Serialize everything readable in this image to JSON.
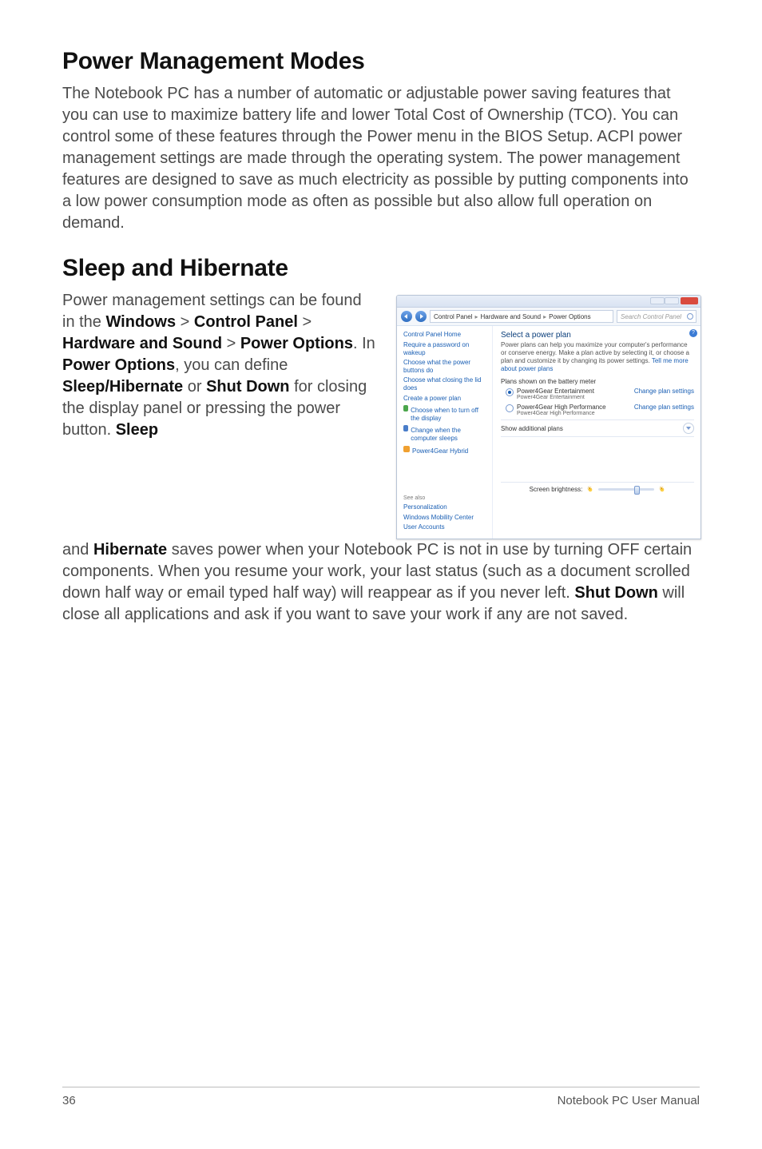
{
  "headings": {
    "h1": "Power Management Modes",
    "h2": "Sleep and Hibernate"
  },
  "paragraphs": {
    "p1": "The Notebook PC has a number of automatic or adjustable power saving features that you can use to maximize battery life and lower Total Cost of Ownership (TCO). You can control some of these features through the Power menu in the BIOS Setup. ACPI power management settings are made through the operating system. The power management features are designed to save as much electricity as possible by putting components into a low power consumption mode as often as possible but also allow full operation on demand.",
    "p2_pre": "Power management settings can be found in the ",
    "p2_b1": "Windows",
    "p2_gt1": " > ",
    "p2_b2": "Control Panel",
    "p2_gt2": " > ",
    "p2_b3": "Hardware and Sound",
    "p2_gt3": " > ",
    "p2_b4": "Power Options",
    "p2_mid1": ". In ",
    "p2_b5": "Power Options",
    "p2_mid2": ", you can define ",
    "p2_b6": "Sleep/Hibernate",
    "p2_or": " or ",
    "p2_b7": "Shut Down",
    "p2_tail": " for closing the display panel or pressing the power button. ",
    "p2_b8": "Sleep",
    "p3_pre": "and ",
    "p3_b1": "Hibernate",
    "p3_mid": " saves power when your Notebook PC is not in use by turning OFF certain components. When you resume your work, your last status (such as a document scrolled down half way or email typed half way) will reappear as if you never left. ",
    "p3_b2": "Shut Down",
    "p3_tail": " will close all applications and ask if you want to save your work if any are not saved."
  },
  "win": {
    "breadcrumb": [
      "Control Panel",
      "Hardware and Sound",
      "Power Options"
    ],
    "search_placeholder": "Search Control Panel",
    "side": {
      "home": "Control Panel Home",
      "links": [
        "Require a password on wakeup",
        "Choose what the power buttons do",
        "Choose what closing the lid does",
        "Create a power plan",
        "Choose when to turn off the display",
        "Change when the computer sleeps",
        "Power4Gear Hybrid"
      ],
      "see_also_header": "See also",
      "see_also": [
        "Personalization",
        "Windows Mobility Center",
        "User Accounts"
      ]
    },
    "main": {
      "title": "Select a power plan",
      "desc_a": "Power plans can help you maximize your computer's performance or conserve energy. Make a plan active by selecting it, or choose a plan and customize it by changing its power settings. ",
      "desc_link": "Tell me more about power plans",
      "group_label": "Plans shown on the battery meter",
      "plans": [
        {
          "name": "Power4Gear Entertainment",
          "sub": "Power4Gear Entertainment",
          "selected": true,
          "change": "Change plan settings"
        },
        {
          "name": "Power4Gear High Performance",
          "sub": "Power4Gear High Performance",
          "selected": false,
          "change": "Change plan settings"
        }
      ],
      "additional": "Show additional plans",
      "brightness_label": "Screen brightness:"
    }
  },
  "footer": {
    "page": "36",
    "title": "Notebook PC User Manual"
  }
}
